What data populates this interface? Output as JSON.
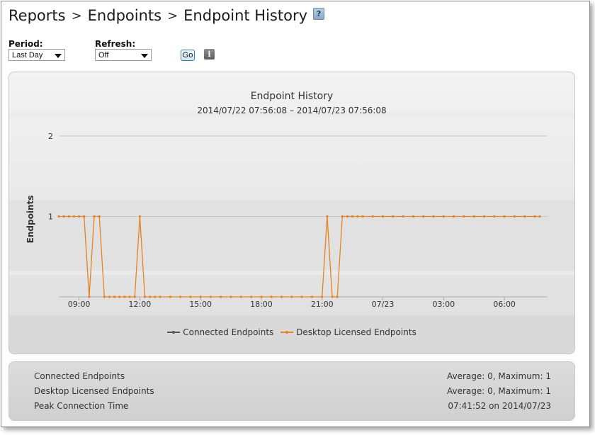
{
  "breadcrumb": {
    "items": [
      "Reports",
      "Endpoints",
      "Endpoint History"
    ],
    "separator": ">",
    "help_icon": "question-mark-icon"
  },
  "controls": {
    "period_label": "Period:",
    "period_value": "Last Day",
    "refresh_label": "Refresh:",
    "refresh_value": "Off",
    "go_label": "Go",
    "info_icon": "info-icon"
  },
  "chart_data": {
    "type": "line",
    "title": "Endpoint History",
    "subtitle": "2014/07/22 07:56:08 – 2014/07/23 07:56:08",
    "ylabel": "Endpoints",
    "xlabel": "",
    "ylim": [
      0,
      2
    ],
    "yticks": [
      1,
      2
    ],
    "xticks": [
      "09:00",
      "12:00",
      "15:00",
      "18:00",
      "21:00",
      "07/23",
      "03:00",
      "06:00"
    ],
    "xtick_positions": [
      9,
      12,
      15,
      18,
      21,
      24,
      27,
      30
    ],
    "xlim": [
      8,
      32.13
    ],
    "grid": true,
    "legend_position": "bottom",
    "series": [
      {
        "name": "Connected Endpoints",
        "color": "#555555",
        "points": []
      },
      {
        "name": "Desktop Licensed Endpoints",
        "color": "#e8821e",
        "points": [
          [
            8.0,
            1
          ],
          [
            8.25,
            1
          ],
          [
            8.5,
            1
          ],
          [
            8.75,
            1
          ],
          [
            9.0,
            1
          ],
          [
            9.25,
            1
          ],
          [
            9.25,
            1
          ],
          [
            9.5,
            0
          ],
          [
            9.75,
            1
          ],
          [
            10.0,
            1
          ],
          [
            10.25,
            0
          ],
          [
            10.5,
            0
          ],
          [
            10.75,
            0
          ],
          [
            11.0,
            0
          ],
          [
            11.25,
            0
          ],
          [
            11.5,
            0
          ],
          [
            11.75,
            0
          ],
          [
            12.0,
            1
          ],
          [
            12.25,
            0
          ],
          [
            12.5,
            0
          ],
          [
            12.75,
            0
          ],
          [
            13.0,
            0
          ],
          [
            13.5,
            0
          ],
          [
            14.0,
            0
          ],
          [
            14.5,
            0
          ],
          [
            15.0,
            0
          ],
          [
            15.5,
            0
          ],
          [
            16.0,
            0
          ],
          [
            16.5,
            0
          ],
          [
            17.0,
            0
          ],
          [
            17.5,
            0
          ],
          [
            18.0,
            0
          ],
          [
            18.5,
            0
          ],
          [
            19.0,
            0
          ],
          [
            19.5,
            0
          ],
          [
            20.0,
            0
          ],
          [
            20.5,
            0
          ],
          [
            21.0,
            0
          ],
          [
            21.25,
            1
          ],
          [
            21.5,
            0
          ],
          [
            21.75,
            0
          ],
          [
            22.0,
            1
          ],
          [
            22.25,
            1
          ],
          [
            22.5,
            1
          ],
          [
            22.75,
            1
          ],
          [
            23.0,
            1
          ],
          [
            23.5,
            1
          ],
          [
            24.0,
            1
          ],
          [
            24.5,
            1
          ],
          [
            25.0,
            1
          ],
          [
            25.5,
            1
          ],
          [
            26.0,
            1
          ],
          [
            26.5,
            1
          ],
          [
            27.0,
            1
          ],
          [
            27.5,
            1
          ],
          [
            28.0,
            1
          ],
          [
            28.5,
            1
          ],
          [
            29.0,
            1
          ],
          [
            29.5,
            1
          ],
          [
            30.0,
            1
          ],
          [
            30.5,
            1
          ],
          [
            31.0,
            1
          ],
          [
            31.5,
            1
          ],
          [
            31.75,
            1
          ]
        ]
      }
    ]
  },
  "stats": [
    {
      "label": "Connected Endpoints",
      "value": "Average: 0, Maximum: 1"
    },
    {
      "label": "Desktop Licensed Endpoints",
      "value": "Average: 0, Maximum: 1"
    },
    {
      "label": "Peak Connection Time",
      "value": "07:41:52 on 2014/07/23"
    }
  ]
}
